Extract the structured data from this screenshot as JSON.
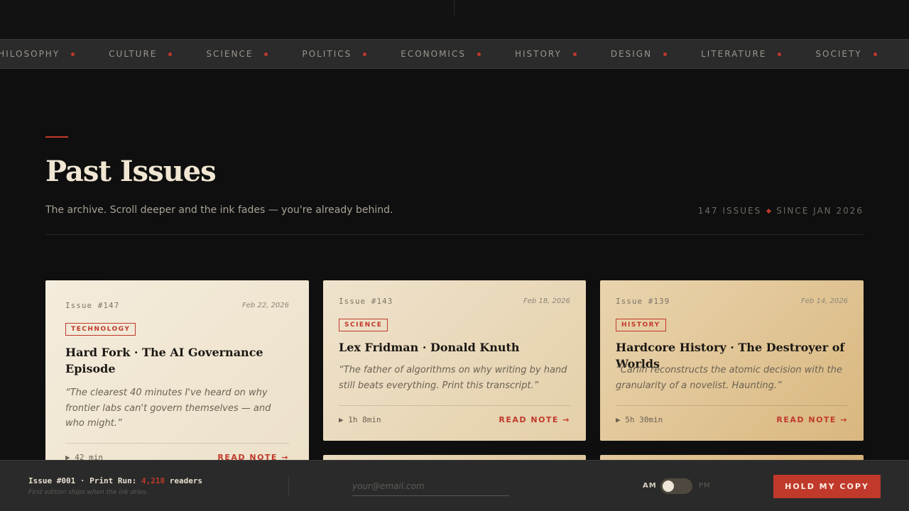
{
  "ticker": {
    "items": [
      "PHILOSOPHY",
      "CULTURE",
      "SCIENCE",
      "POLITICS",
      "ECONOMICS",
      "HISTORY",
      "DESIGN",
      "LITERATURE",
      "SOCIETY"
    ]
  },
  "header": {
    "title": "Past Issues",
    "subtitle": "The archive. Scroll deeper and the ink fades — you're already behind.",
    "issue_count": "147 ISSUES",
    "since": "SINCE JAN 2026"
  },
  "cards": [
    {
      "number": "Issue #147",
      "date": "Feb 22, 2026",
      "tag": "TECHNOLOGY",
      "title_line1": "Hard Fork · The AI Governance",
      "title_line2": "Episode",
      "quote_line1": "“The clearest 40 minutes I've heard on why",
      "quote_line2": "frontier labs can't govern themselves — and",
      "quote_line3": "who might.”",
      "duration": "▶ 42 min",
      "read": "READ NOTE →"
    },
    {
      "number": "Issue #143",
      "date": "Feb 18, 2026",
      "tag": "SCIENCE",
      "title_line1": "Lex Fridman · Donald Knuth",
      "quote_line1": "“The father of algorithms on why writing by hand",
      "quote_line2": "still beats everything. Print this transcript.”",
      "duration": "▶ 1h 8min",
      "read": "READ NOTE →"
    },
    {
      "number": "Issue #139",
      "date": "Feb 14, 2026",
      "tag": "HISTORY",
      "title_line1": "Hardcore History · The Destroyer of Worlds",
      "quote_line1": "“Carlin reconstructs the atomic decision with the",
      "quote_line2": "granularity of a novelist. Haunting.”",
      "duration": "▶ 5h 30min",
      "read": "READ NOTE →"
    }
  ],
  "footer": {
    "edition_prefix": "Issue #001 · Print Run: ",
    "readers": "4,218",
    "edition_suffix": " readers",
    "note": "First edition ships when the ink dries.",
    "email_placeholder": "your@email.com",
    "am": "AM",
    "pm": "PM",
    "cta": "HOLD MY COPY"
  },
  "colors": {
    "accent": "#c0392b",
    "background": "#0f0f0f",
    "paper": "#f4ecdc"
  }
}
